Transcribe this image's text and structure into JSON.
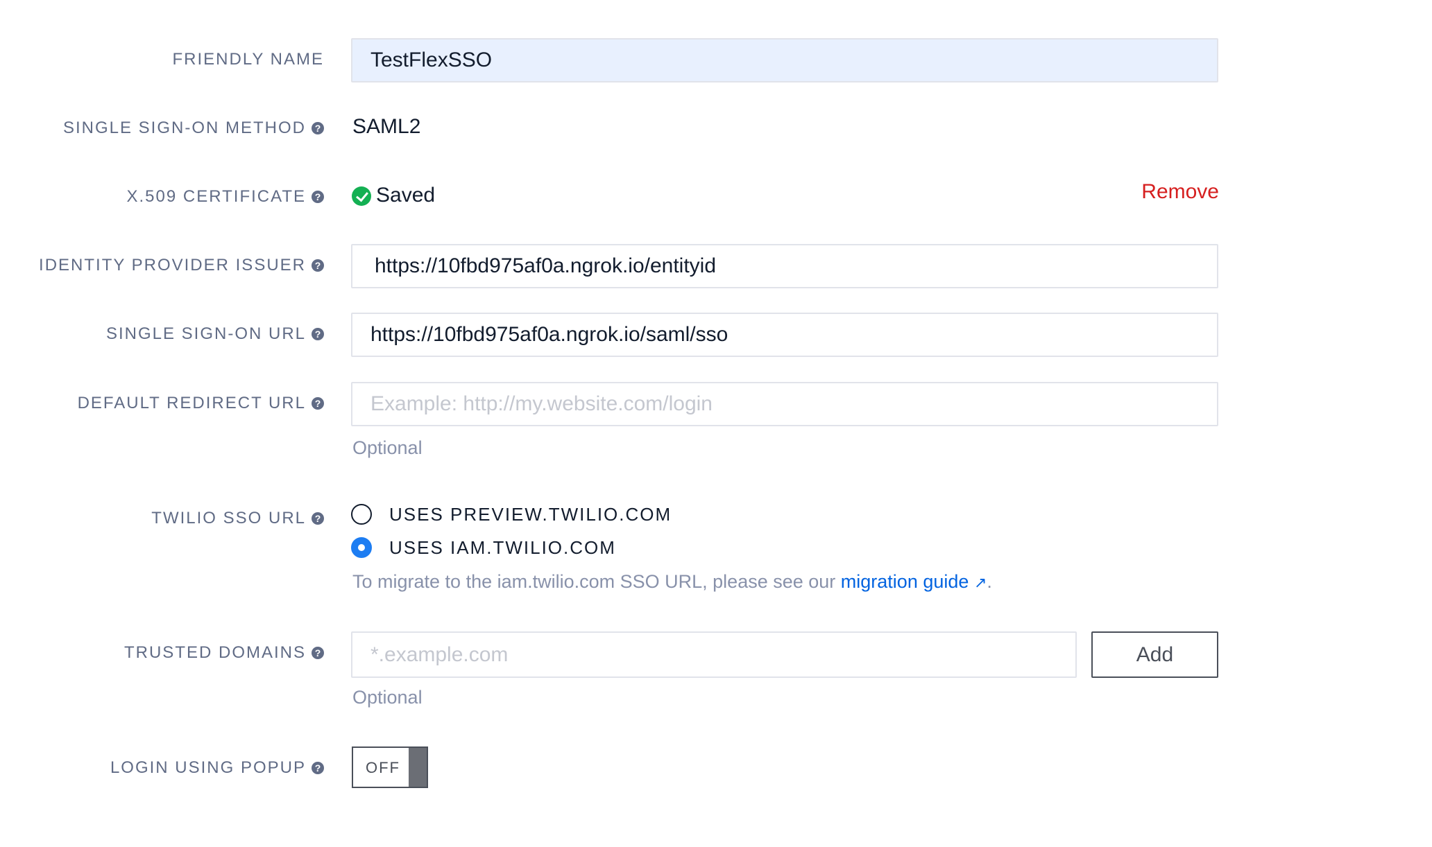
{
  "form": {
    "friendly_name": {
      "label": "FRIENDLY NAME",
      "value": "TestFlexSSO"
    },
    "sso_method": {
      "label": "SINGLE SIGN-ON METHOD",
      "value": "SAML2"
    },
    "certificate": {
      "label": "X.509 CERTIFICATE",
      "status": "Saved",
      "remove_label": "Remove"
    },
    "idp_issuer": {
      "label": "IDENTITY PROVIDER ISSUER",
      "value": "https://10fbd975af0a.ngrok.io/entityid"
    },
    "sso_url": {
      "label": "SINGLE SIGN-ON URL",
      "value": "https://10fbd975af0a.ngrok.io/saml/sso"
    },
    "redirect_url": {
      "label": "DEFAULT REDIRECT URL",
      "placeholder": "Example: http://my.website.com/login",
      "hint": "Optional"
    },
    "twilio_sso_url": {
      "label": "TWILIO SSO URL",
      "options": [
        {
          "label": "USES PREVIEW.TWILIO.COM",
          "checked": false
        },
        {
          "label": "USES IAM.TWILIO.COM",
          "checked": true
        }
      ],
      "note_prefix": "To migrate to the iam.twilio.com SSO URL, please see our ",
      "note_link": "migration guide",
      "note_link_icon": "↗",
      "note_suffix": "."
    },
    "trusted_domains": {
      "label": "TRUSTED DOMAINS",
      "placeholder": "*.example.com",
      "add_label": "Add",
      "hint": "Optional"
    },
    "login_popup": {
      "label": "LOGIN USING POPUP",
      "state": "OFF"
    }
  },
  "icons": {
    "help": "?"
  },
  "colors": {
    "label": "#606b85",
    "remove": "#d61f1f",
    "link": "#0263e0",
    "success": "#14b053",
    "radio_checked": "#1d7df2",
    "autofill_bg": "#e8f0fe"
  }
}
